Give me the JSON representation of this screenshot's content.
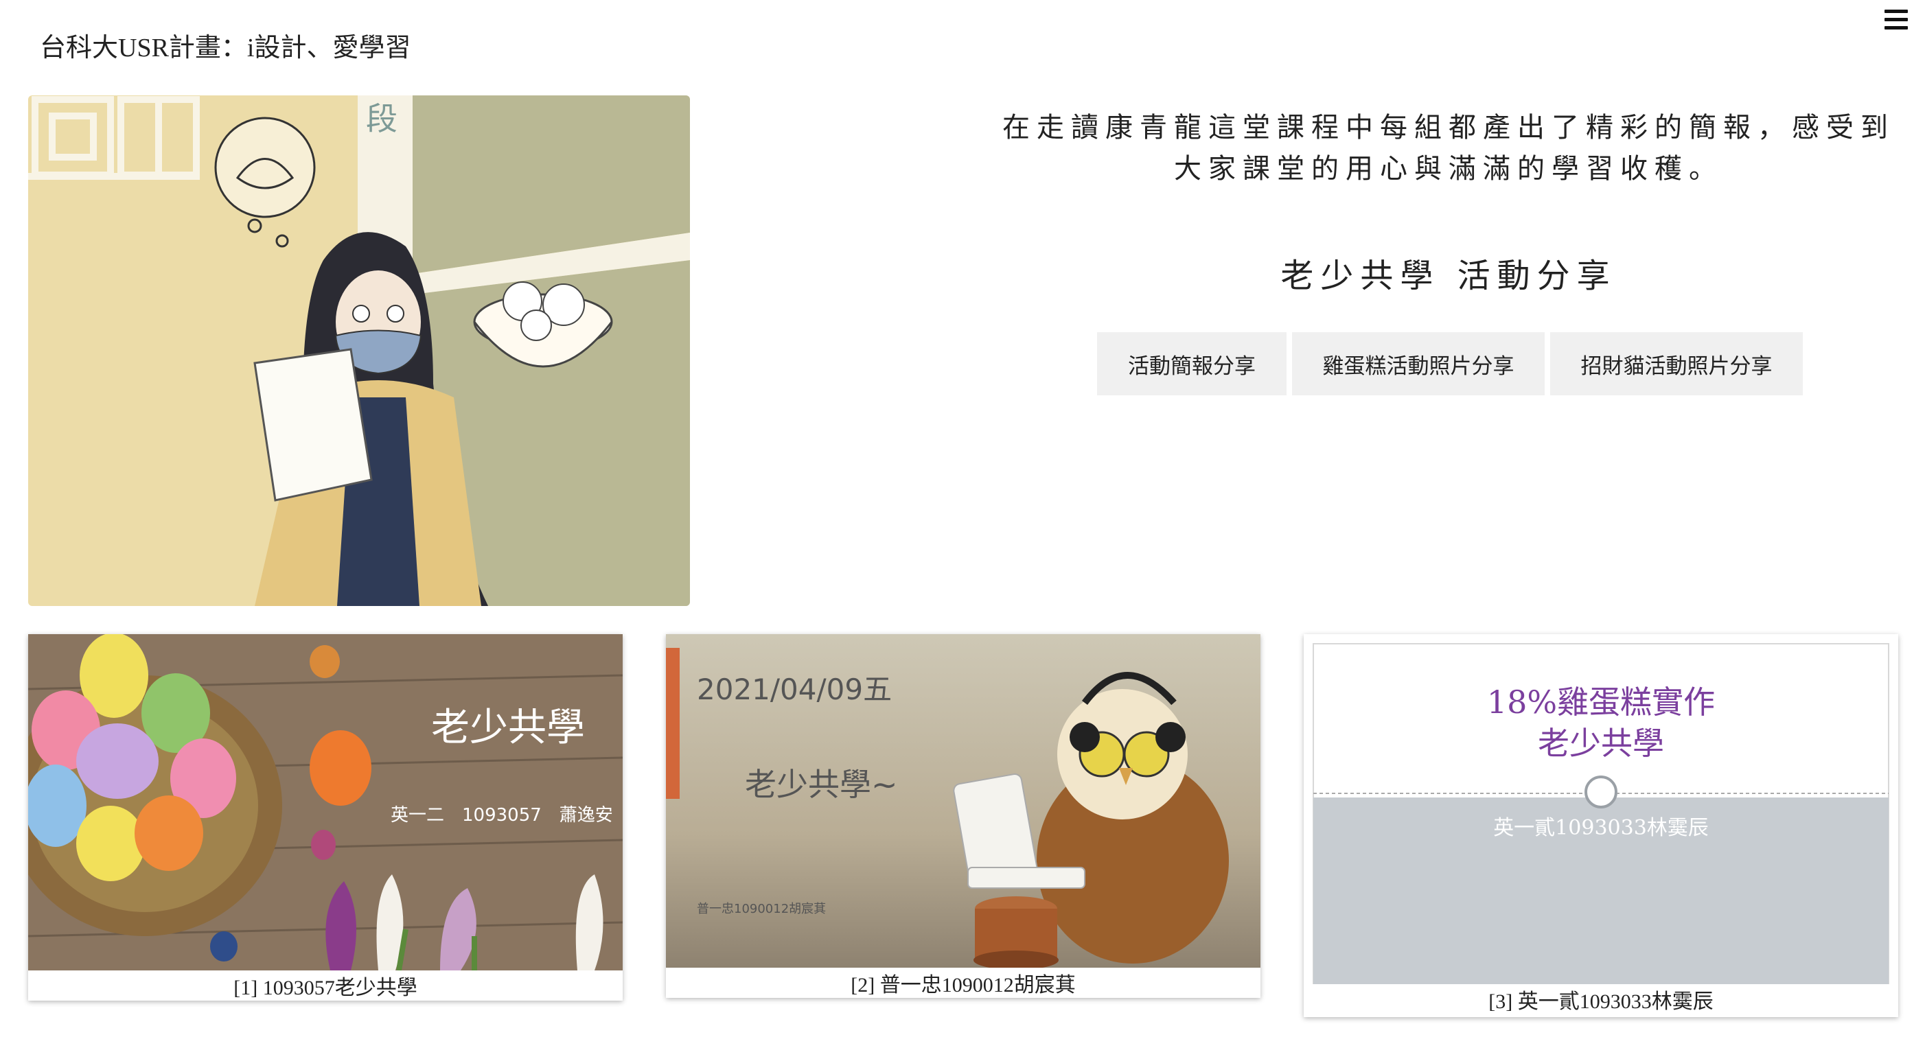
{
  "header": {
    "site_title": "台科大USR計畫：i設計、愛學習",
    "menu_icon": "hamburger-menu-icon"
  },
  "hero": {
    "icon": "illustration-student-with-mask",
    "sign_text": "段"
  },
  "intro": {
    "line1": "在走讀康青龍這堂課程中每組都產出了精彩的簡報，感受到",
    "line2": "大家課堂的用心與滿滿的學習收穫。"
  },
  "section": {
    "heading": "老少共學 活動分享",
    "buttons": [
      "活動簡報分享",
      "雞蛋糕活動照片分享",
      "招財貓活動照片分享"
    ]
  },
  "cards": [
    {
      "caption": "[1] 1093057老少共學",
      "slide_title": "老少共學",
      "slide_sub": "英一二　1093057　蕭逸安"
    },
    {
      "caption": "[2] 普一忠1090012胡宸萁",
      "slide_date": "2021/04/09五",
      "slide_title": "老少共學~",
      "slide_small": "普一忠1090012胡宸萁"
    },
    {
      "caption": "[3] 英一貳1093033林霙辰",
      "slide_title_1": "18%雞蛋糕實作",
      "slide_title_2": "老少共學",
      "slide_sub": "英一貳1093033林霙辰"
    }
  ],
  "colors": {
    "hero_yellow": "#ecdca8",
    "hero_olive": "#b9b894",
    "button_bg": "#f0f0f0",
    "slide3_title": "#7b3f9e",
    "slide3_band": "#c7ccd1",
    "slide2_accent": "#d2673a"
  }
}
